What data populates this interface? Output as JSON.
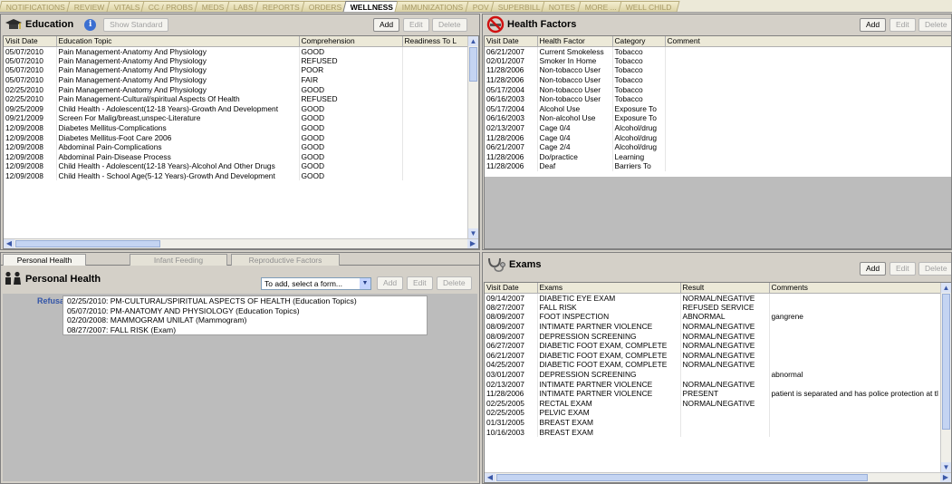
{
  "tabs": [
    "NOTIFICATIONS",
    "REVIEW",
    "VITALS",
    "CC / PROBS",
    "MEDS",
    "LABS",
    "REPORTS",
    "ORDERS",
    "WELLNESS",
    "IMMUNIZATIONS",
    "POV",
    "SUPERBILL",
    "NOTES",
    "MORE ...",
    "WELL CHILD"
  ],
  "active_tab": "WELLNESS",
  "education": {
    "title": "Education",
    "show_standard": "Show Standard",
    "buttons": {
      "add": "Add",
      "edit": "Edit",
      "delete": "Delete"
    },
    "columns": [
      "Visit Date",
      "Education Topic",
      "Comprehension",
      "Readiness To L"
    ],
    "rows": [
      [
        "05/07/2010",
        "Pain Management-Anatomy And Physiology",
        "GOOD",
        ""
      ],
      [
        "05/07/2010",
        "Pain Management-Anatomy And Physiology",
        "REFUSED",
        ""
      ],
      [
        "05/07/2010",
        "Pain Management-Anatomy And Physiology",
        "POOR",
        ""
      ],
      [
        "05/07/2010",
        "Pain Management-Anatomy And Physiology",
        "FAIR",
        ""
      ],
      [
        "02/25/2010",
        "Pain Management-Anatomy And Physiology",
        "GOOD",
        ""
      ],
      [
        "02/25/2010",
        "Pain Management-Cultural/spiritual Aspects Of Health",
        "REFUSED",
        ""
      ],
      [
        "09/25/2009",
        "Child Health - Adolescent(12-18 Years)-Growth And Development",
        "GOOD",
        ""
      ],
      [
        "09/21/2009",
        "Screen For Malig/breast,unspec-Literature",
        "GOOD",
        ""
      ],
      [
        "12/09/2008",
        "Diabetes Mellitus-Complications",
        "GOOD",
        ""
      ],
      [
        "12/09/2008",
        "Diabetes Mellitus-Foot Care 2006",
        "GOOD",
        ""
      ],
      [
        "12/09/2008",
        "Abdominal Pain-Complications",
        "GOOD",
        ""
      ],
      [
        "12/09/2008",
        "Abdominal Pain-Disease Process",
        "GOOD",
        ""
      ],
      [
        "12/09/2008",
        "Child Health - Adolescent(12-18 Years)-Alcohol And Other Drugs",
        "GOOD",
        ""
      ],
      [
        "12/09/2008",
        "Child Health - School Age(5-12 Years)-Growth And Development",
        "GOOD",
        ""
      ]
    ]
  },
  "health_factors": {
    "title": "Health Factors",
    "buttons": {
      "add": "Add",
      "edit": "Edit",
      "delete": "Delete"
    },
    "columns": [
      "Visit Date",
      "Health Factor",
      "Category",
      "Comment"
    ],
    "rows": [
      [
        "06/21/2007",
        "Current Smokeless",
        "Tobacco",
        ""
      ],
      [
        "02/01/2007",
        "Smoker In Home",
        "Tobacco",
        ""
      ],
      [
        "11/28/2006",
        "Non-tobacco User",
        "Tobacco",
        ""
      ],
      [
        "11/28/2006",
        "Non-tobacco User",
        "Tobacco",
        ""
      ],
      [
        "05/17/2004",
        "Non-tobacco User",
        "Tobacco",
        ""
      ],
      [
        "06/16/2003",
        "Non-tobacco User",
        "Tobacco",
        ""
      ],
      [
        "05/17/2004",
        "Alcohol Use",
        "Exposure To",
        ""
      ],
      [
        "06/16/2003",
        "Non-alcohol Use",
        "Exposure To",
        ""
      ],
      [
        "02/13/2007",
        "Cage 0/4",
        "Alcohol/drug",
        ""
      ],
      [
        "11/28/2006",
        "Cage 0/4",
        "Alcohol/drug",
        ""
      ],
      [
        "06/21/2007",
        "Cage 2/4",
        "Alcohol/drug",
        ""
      ],
      [
        "11/28/2006",
        "Do/practice",
        "Learning",
        ""
      ],
      [
        "11/28/2006",
        "Deaf",
        "Barriers To",
        ""
      ]
    ]
  },
  "personal_health": {
    "subtabs": [
      "Personal Health",
      "Infant Feeding",
      "Reproductive Factors"
    ],
    "title": "Personal Health",
    "select_placeholder": "To add, select a form...",
    "buttons": {
      "add": "Add",
      "edit": "Edit",
      "delete": "Delete"
    },
    "refusal_label": "Refusal",
    "items": [
      "02/25/2010: PM-CULTURAL/SPIRITUAL ASPECTS OF HEALTH (Education Topics)",
      "05/07/2010: PM-ANATOMY AND PHYSIOLOGY (Education Topics)",
      "02/20/2008: MAMMOGRAM UNILAT (Mammogram)",
      "08/27/2007: FALL RISK (Exam)"
    ]
  },
  "exams": {
    "title": "Exams",
    "buttons": {
      "add": "Add",
      "edit": "Edit",
      "delete": "Delete"
    },
    "columns": [
      "Visit Date",
      "Exams",
      "Result",
      "Comments"
    ],
    "rows": [
      [
        "09/14/2007",
        "DIABETIC EYE EXAM",
        "NORMAL/NEGATIVE",
        ""
      ],
      [
        "08/27/2007",
        "FALL RISK",
        "REFUSED SERVICE",
        ""
      ],
      [
        "08/09/2007",
        "FOOT INSPECTION",
        "ABNORMAL",
        "gangrene"
      ],
      [
        "08/09/2007",
        "INTIMATE PARTNER VIOLENCE",
        "NORMAL/NEGATIVE",
        ""
      ],
      [
        "08/09/2007",
        "DEPRESSION SCREENING",
        "NORMAL/NEGATIVE",
        ""
      ],
      [
        "06/27/2007",
        "DIABETIC FOOT EXAM, COMPLETE",
        "NORMAL/NEGATIVE",
        ""
      ],
      [
        "06/21/2007",
        "DIABETIC FOOT EXAM, COMPLETE",
        "NORMAL/NEGATIVE",
        ""
      ],
      [
        "04/25/2007",
        "DIABETIC FOOT EXAM, COMPLETE",
        "NORMAL/NEGATIVE",
        ""
      ],
      [
        "03/01/2007",
        "DEPRESSION SCREENING",
        "",
        "abnormal"
      ],
      [
        "02/13/2007",
        "INTIMATE PARTNER VIOLENCE",
        "NORMAL/NEGATIVE",
        ""
      ],
      [
        "11/28/2006",
        "INTIMATE PARTNER VIOLENCE",
        "PRESENT",
        "patient is separated and has police protection at tl"
      ],
      [
        "02/25/2005",
        "RECTAL EXAM",
        "NORMAL/NEGATIVE",
        ""
      ],
      [
        "02/25/2005",
        "PELVIC EXAM",
        "",
        ""
      ],
      [
        "01/31/2005",
        "BREAST EXAM",
        "",
        ""
      ],
      [
        "10/16/2003",
        "BREAST EXAM",
        "",
        ""
      ]
    ]
  }
}
